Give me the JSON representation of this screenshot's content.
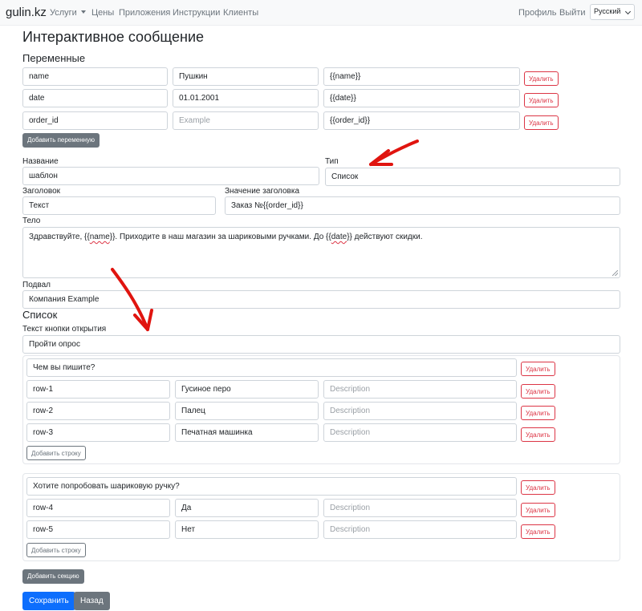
{
  "navbar": {
    "brand": "gulin.kz",
    "links": [
      "Услуги",
      "Цены",
      "Приложения",
      "Инструкции",
      "Клиенты"
    ],
    "profile": "Профиль",
    "logout": "Выйти",
    "language": "Русский"
  },
  "page_title": "Интерактивное сообщение",
  "variables": {
    "heading": "Переменные",
    "rows": [
      {
        "name": "name",
        "value": "Пушкин",
        "value_placeholder": "",
        "token": "{{name}}"
      },
      {
        "name": "date",
        "value": "01.01.2001",
        "value_placeholder": "",
        "token": "{{date}}"
      },
      {
        "name": "order_id",
        "value": "",
        "value_placeholder": "Example",
        "token": "{{order_id}}"
      }
    ],
    "delete_label": "Удалить",
    "add_label": "Добавить переменную"
  },
  "form": {
    "name_label": "Название",
    "name_value": "шаблон",
    "type_label": "Тип",
    "type_value": "Список",
    "header_label": "Заголовок",
    "header_value": "Текст",
    "header_value_label": "Значение заголовка",
    "header_value_value": "Заказ №{{order_id}}",
    "body_label": "Тело",
    "body_parts": [
      "Здравствуйте, {{",
      "name",
      "}}. Приходите в наш магазин за шариковыми ручками. До {{",
      "date",
      "}} действуют скидки."
    ],
    "footer_label": "Подвал",
    "footer_value": "Компания Example"
  },
  "list": {
    "heading": "Список",
    "button_label": "Текст кнопки открытия",
    "button_value": "Пройти опрос",
    "delete_label": "Удалить",
    "add_row_label": "Добавить строку",
    "add_section_label": "Добавить секцию",
    "sections": [
      {
        "title": "Чем вы пишите?",
        "rows": [
          {
            "id": "row-1",
            "title": "Гусиное перо",
            "desc_placeholder": "Description"
          },
          {
            "id": "row-2",
            "title": "Палец",
            "desc_placeholder": "Description"
          },
          {
            "id": "row-3",
            "title": "Печатная машинка",
            "desc_placeholder": "Description"
          }
        ]
      },
      {
        "title": "Хотите попробовать шариковую ручку?",
        "rows": [
          {
            "id": "row-4",
            "title": "Да",
            "desc_placeholder": "Description"
          },
          {
            "id": "row-5",
            "title": "Нет",
            "desc_placeholder": "Description"
          }
        ]
      }
    ]
  },
  "actions": {
    "save": "Сохранить",
    "back": "Назад"
  },
  "colors": {
    "primary": "#0d6efd",
    "danger": "#dc3545",
    "secondary": "#6c757d",
    "annotation_arrow": "#e0140f"
  }
}
